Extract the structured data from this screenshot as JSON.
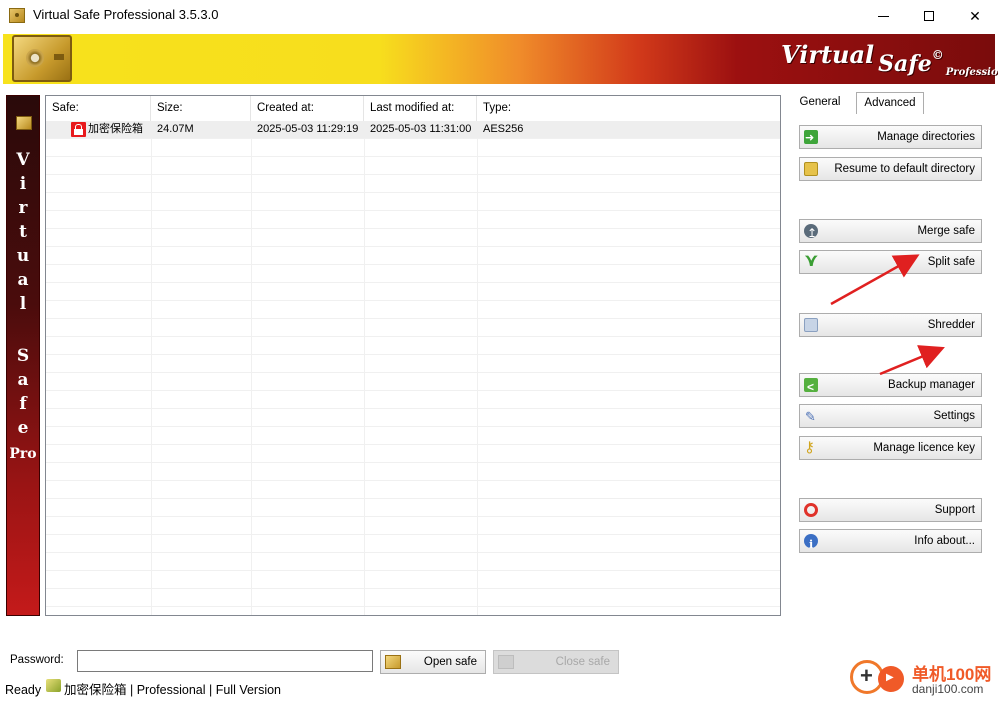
{
  "window": {
    "title": "Virtual Safe Professional 3.5.3.0",
    "controls": {
      "minimize": "",
      "maximize": "",
      "close": "✕"
    }
  },
  "banner": {
    "logo_virtual": "Virtual",
    "logo_safe": "Safe",
    "logo_reg": "©",
    "logo_pro": "Professional"
  },
  "sidebar": {
    "letters": [
      "V",
      "i",
      "r",
      "t",
      "u",
      "a",
      "l",
      "S",
      "a",
      "f",
      "e"
    ],
    "pro": "Pro"
  },
  "list": {
    "columns": [
      "Safe:",
      "Size:",
      "Created at:",
      "Last modified at:",
      "Type:"
    ],
    "rows": [
      {
        "safe": "加密保险箱",
        "size": "24.07M",
        "created": "2025-05-03 11:29:19",
        "modified": "2025-05-03 11:31:00",
        "type": "AES256"
      }
    ]
  },
  "tabs": {
    "general": "General",
    "advanced": "Advanced",
    "active": "Advanced"
  },
  "actions": {
    "manage_directories": "Manage directories",
    "resume_default": "Resume to default directory",
    "merge_safe": "Merge safe",
    "split_safe": "Split safe",
    "shredder": "Shredder",
    "backup_manager": "Backup manager",
    "settings": "Settings",
    "manage_licence": "Manage licence key",
    "support": "Support",
    "info_about": "Info about..."
  },
  "password": {
    "label": "Password:",
    "value": "",
    "open_label": "Open safe",
    "close_label": "Close safe"
  },
  "status": {
    "ready": "Ready",
    "safe_name": "加密保险箱",
    "edition": "| Professional | Full Version"
  },
  "watermark": {
    "cn": "单机100网",
    "url": "danji100.com"
  },
  "colors": {
    "banner_yellow": "#f7e21c",
    "banner_red": "#7a0c0c",
    "lock_red": "#e8191c",
    "arrow_red": "#e02020"
  }
}
